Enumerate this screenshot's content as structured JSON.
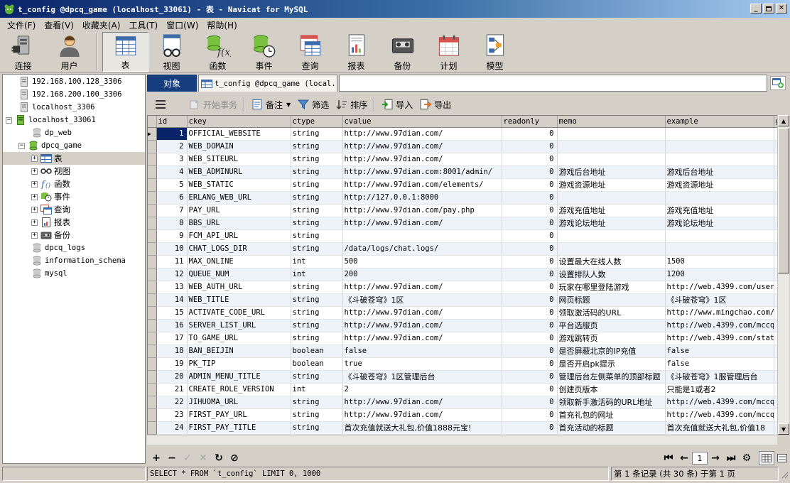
{
  "window": {
    "title": "t_config @dpcq_game (localhost_33061) - 表 - Navicat for MySQL"
  },
  "menu": [
    "文件(F)",
    "查看(V)",
    "收藏夹(A)",
    "工具(T)",
    "窗口(W)",
    "帮助(H)"
  ],
  "toolbar": {
    "connect": "连接",
    "user": "用户",
    "table": "表",
    "view": "视图",
    "function": "函数",
    "event": "事件",
    "query": "查询",
    "report": "报表",
    "backup": "备份",
    "schedule": "计划",
    "model": "模型"
  },
  "tree": {
    "connections": [
      "192.168.100.128_3306",
      "192.168.200.100_3306",
      "localhost_3306",
      "localhost_33061"
    ],
    "databases": [
      "dp_web",
      "dpcq_game",
      "dpcq_logs",
      "information_schema",
      "mysql"
    ],
    "nodes": [
      "表",
      "视图",
      "函数",
      "事件",
      "查询",
      "报表",
      "备份"
    ]
  },
  "tabs": {
    "objects": "对象",
    "table_tab": "t_config @dpcq_game (local..."
  },
  "datatoolbar": {
    "begin_tx": "开始事务",
    "memo": "备注",
    "filter": "筛选",
    "sort": "排序",
    "import": "导入",
    "export": "导出"
  },
  "grid": {
    "columns": [
      "id",
      "ckey",
      "ctype",
      "cvalue",
      "readonly",
      "memo",
      "example",
      "g"
    ],
    "rows": [
      [
        "1",
        "OFFICIAL_WEBSITE",
        "string",
        "http://www.97dian.com/",
        "0",
        "",
        ""
      ],
      [
        "2",
        "WEB_DOMAIN",
        "string",
        "http://www.97dian.com/",
        "0",
        "",
        ""
      ],
      [
        "3",
        "WEB_SITEURL",
        "string",
        "http://www.97dian.com/",
        "0",
        "",
        ""
      ],
      [
        "4",
        "WEB_ADMINURL",
        "string",
        "http://www.97dian.com:8001/admin/",
        "0",
        "游戏后台地址",
        "游戏后台地址"
      ],
      [
        "5",
        "WEB_STATIC",
        "string",
        "http://www.97dian.com/elements/",
        "0",
        "游戏资源地址",
        "游戏资源地址"
      ],
      [
        "6",
        "ERLANG_WEB_URL",
        "string",
        "http://127.0.0.1:8000",
        "0",
        "",
        ""
      ],
      [
        "7",
        "PAY_URL",
        "string",
        "http://www.97dian.com/pay.php",
        "0",
        "游戏充值地址",
        "游戏充值地址"
      ],
      [
        "8",
        "BBS_URL",
        "string",
        "http://www.97dian.com/",
        "0",
        "游戏论坛地址",
        "游戏论坛地址"
      ],
      [
        "9",
        "FCM_API_URL",
        "string",
        "",
        "0",
        "",
        ""
      ],
      [
        "10",
        "CHAT_LOGS_DIR",
        "string",
        "/data/logs/chat.logs/",
        "0",
        "",
        ""
      ],
      [
        "11",
        "MAX_ONLINE",
        "int",
        "500",
        "0",
        "设置最大在线人数",
        "1500"
      ],
      [
        "12",
        "QUEUE_NUM",
        "int",
        "200",
        "0",
        "设置排队人数",
        "1200"
      ],
      [
        "13",
        "WEB_AUTH_URL",
        "string",
        "http://www.97dian.com/",
        "0",
        "玩家在哪里登陆游戏",
        "http://web.4399.com/user/"
      ],
      [
        "14",
        "WEB_TITLE",
        "string",
        "《斗破苍穹》1区",
        "0",
        "网页标题",
        "《斗破苍穹》1区"
      ],
      [
        "15",
        "ACTIVATE_CODE_URL",
        "string",
        "http://www.97dian.com/",
        "0",
        "领取激活码的URL",
        "http://www.mingchao.com/x"
      ],
      [
        "16",
        "SERVER_LIST_URL",
        "string",
        "http://www.97dian.com/",
        "0",
        "平台选服页",
        "http://web.4399.com/mccq/"
      ],
      [
        "17",
        "TO_GAME_URL",
        "string",
        "http://www.97dian.com/",
        "0",
        "游戏跳转页",
        "http://web.4399.com/stat/"
      ],
      [
        "18",
        "BAN_BEIJIN",
        "boolean",
        "false",
        "0",
        "是否屏蔽北京的IP充值",
        "false"
      ],
      [
        "19",
        "PK_TIP",
        "boolean",
        "true",
        "0",
        "是否开启pk提示",
        "false"
      ],
      [
        "20",
        "ADMIN_MENU_TITLE",
        "string",
        "《斗破苍穹》1区管理后台",
        "0",
        "管理后台左侧菜单的顶部标题",
        "《斗破苍穹》1服管理后台"
      ],
      [
        "21",
        "CREATE_ROLE_VERSION",
        "int",
        "2",
        "0",
        "创建页版本",
        "只能是1或者2"
      ],
      [
        "22",
        "JIHUOMA_URL",
        "string",
        "http://www.97dian.com/",
        "0",
        "领取新手激活码的URL地址",
        "http://web.4399.com/mccq/"
      ],
      [
        "23",
        "FIRST_PAY_URL",
        "string",
        "http://www.97dian.com/",
        "0",
        "首充礼包的网址",
        "http://web.4399.com/mccq/"
      ],
      [
        "24",
        "FIRST_PAY_TITLE",
        "string",
        "首次充值就送大礼包,价值1888元宝!",
        "0",
        "首充活动的标题",
        "首次充值就送大礼包,价值18"
      ]
    ]
  },
  "navbar": {
    "page": "1"
  },
  "status": {
    "sql": "SELECT * FROM `t_config` LIMIT 0, 1000",
    "records": "第 1 条记录 (共 30 条) 于第 1 页"
  },
  "colors": {
    "title_start": "#0a246a",
    "title_end": "#a6caf0",
    "tab_active": "#163d7e",
    "selection": "#0a246a",
    "chrome": "#d4d0c8"
  }
}
